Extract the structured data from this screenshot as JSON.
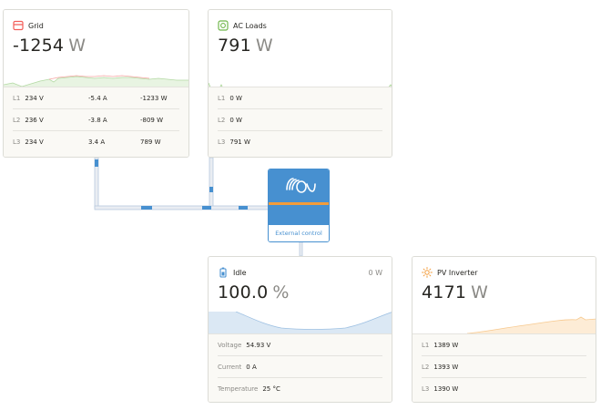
{
  "grid": {
    "title": "Grid",
    "value": "-1254",
    "unit": "W",
    "rows": [
      {
        "phase": "L1",
        "voltage": "234 V",
        "current": "-5.4 A",
        "power": "-1233 W"
      },
      {
        "phase": "L2",
        "voltage": "236 V",
        "current": "-3.8 A",
        "power": "-809 W"
      },
      {
        "phase": "L3",
        "voltage": "234 V",
        "current": "3.4 A",
        "power": "789 W"
      }
    ],
    "icon": "grid-icon",
    "color": "#f35c58"
  },
  "ac_loads": {
    "title": "AC Loads",
    "value": "791",
    "unit": "W",
    "rows": [
      {
        "phase": "L1",
        "power": "0 W"
      },
      {
        "phase": "L2",
        "power": "0 W"
      },
      {
        "phase": "L3",
        "power": "791 W"
      }
    ],
    "icon": "ac-loads-icon",
    "color": "#72b84c"
  },
  "inverter": {
    "label": "External control",
    "icon": "victron-logo-icon",
    "color": "#4790d0",
    "accent": "#f39c3a"
  },
  "battery": {
    "title": "Idle",
    "power": "0 W",
    "value": "100.0",
    "unit": "%",
    "rows": [
      {
        "label": "Voltage",
        "value": "54.93 V"
      },
      {
        "label": "Current",
        "value": "0 A"
      },
      {
        "label": "Temperature",
        "value": "25 °C"
      }
    ],
    "icon": "battery-icon",
    "color": "#4790d0"
  },
  "pv_inverter": {
    "title": "PV Inverter",
    "value": "4171",
    "unit": "W",
    "rows": [
      {
        "phase": "L1",
        "power": "1389 W"
      },
      {
        "phase": "L2",
        "power": "1393 W"
      },
      {
        "phase": "L3",
        "power": "1390 W"
      }
    ],
    "icon": "sun-icon",
    "color": "#f39c3a"
  }
}
